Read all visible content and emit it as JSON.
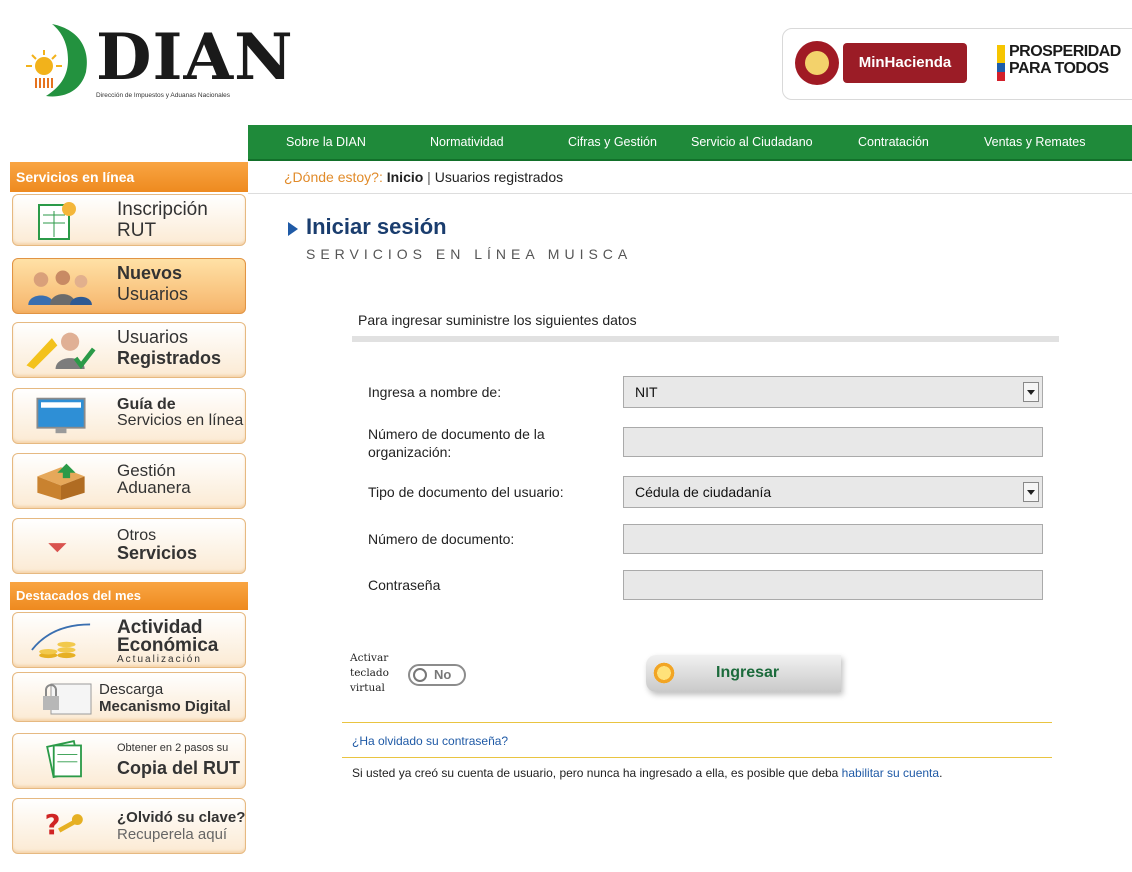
{
  "header": {
    "logo_text": "DIAN",
    "logo_subtitle": "Dirección de Impuestos y Aduanas Nacionales",
    "partner_minhacienda": "MinHacienda",
    "partner_prosperidad_line1": "PROSPERIDAD",
    "partner_prosperidad_line2": "PARA TODOS"
  },
  "topnav": [
    "Sobre la DIAN",
    "Normatividad",
    "Cifras y Gestión",
    "Servicio al Ciudadano",
    "Contratación",
    "Ventas y Remates"
  ],
  "breadcrumb": {
    "question": "¿Dónde estoy?:",
    "home": "Inicio",
    "separator": " | ",
    "current": "Usuarios registrados"
  },
  "sidebar": {
    "section1_title": "Servicios en línea",
    "section2_title": "Destacados del mes",
    "items": [
      {
        "line1": "Inscripción",
        "line2": "RUT"
      },
      {
        "line1": "Nuevos",
        "line2": "Usuarios"
      },
      {
        "line1": "Usuarios",
        "line2": "Registrados"
      },
      {
        "line1": "Guía de",
        "line2": "Servicios en línea"
      },
      {
        "line1": "Gestión",
        "line2": "Aduanera"
      },
      {
        "line1": "Otros",
        "line2": "Servicios"
      }
    ],
    "featured": [
      {
        "line1": "Actividad",
        "line2": "Económica",
        "line3": "Actualización"
      },
      {
        "line1": "Descarga",
        "line2": "Mecanismo Digital"
      },
      {
        "line1": "Obtener en 2 pasos su",
        "line2": "Copia del RUT"
      },
      {
        "line1": "¿Olvidó su clave?",
        "line2": "Recuperela aquí"
      }
    ]
  },
  "main": {
    "title": "Iniciar sesión",
    "subtitle": "SERVICIOS EN LÍNEA MUISCA",
    "intro": "Para ingresar suministre los siguientes datos",
    "fields": {
      "on_behalf_label": "Ingresa a nombre de:",
      "on_behalf_value": "NIT",
      "org_doc_label_1": "Número de documento de la",
      "org_doc_label_2": "organización:",
      "doc_type_label": "Tipo de documento del usuario:",
      "doc_type_value": "Cédula de ciudadanía",
      "doc_number_label": "Número de documento:",
      "password_label": "Contraseña"
    },
    "virtual_keyboard": {
      "line1": "Activar",
      "line2": "teclado",
      "line3": "virtual",
      "state": "No"
    },
    "login_button": "Ingresar",
    "forgot_password": "¿Ha olvidado su contraseña?",
    "note_text": "Si usted ya creó su cuenta de usuario, pero nunca ha ingresado a ella, es posible que deba ",
    "note_link": "habilitar su cuenta",
    "note_end": "."
  },
  "colors": {
    "nav_green": "#1f8a3a",
    "sidebar_orange": "#ee8a1f",
    "title_blue": "#1a3d6e",
    "link_blue": "#1f5aa6"
  }
}
